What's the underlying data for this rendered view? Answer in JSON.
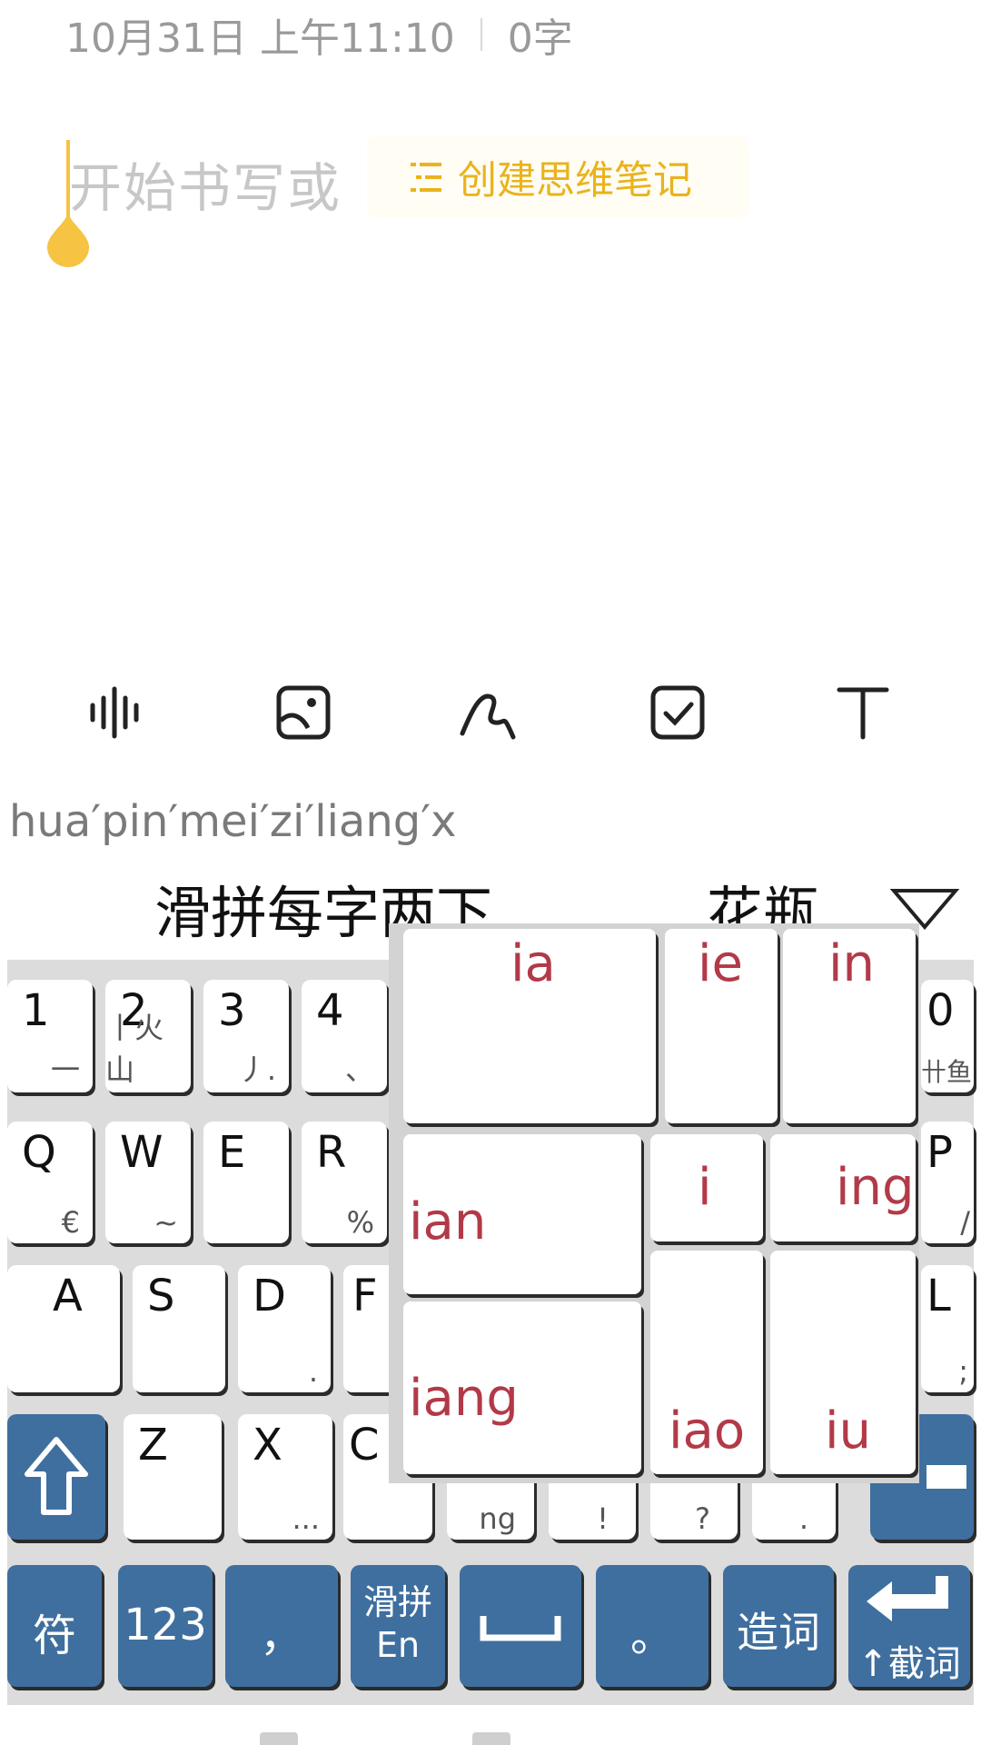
{
  "note": {
    "date_time": "10月31日 上午11:10",
    "word_count": "0字",
    "placeholder": "开始书写或",
    "mindmap_button_label": "创建思维笔记",
    "accent_color": "#eab31d"
  },
  "toolbar": {
    "icons": [
      "voice-icon",
      "image-icon",
      "handwriting-icon",
      "checkbox-icon",
      "text-format-icon"
    ]
  },
  "ime": {
    "composition": "hua′pin′mei′zi′liang′x",
    "candidates": [
      "滑拼每字两下",
      "花瓶"
    ]
  },
  "keyboard": {
    "row1": [
      {
        "main": "1",
        "sub": "一"
      },
      {
        "main": "2",
        "sub": "丨火山"
      },
      {
        "main": "3",
        "sub": "丿."
      },
      {
        "main": "4",
        "sub": "、"
      },
      {
        "main": "0",
        "sub": "卄鱼"
      }
    ],
    "row2": [
      {
        "main": "Q",
        "sub": "€"
      },
      {
        "main": "W",
        "sub": "~"
      },
      {
        "main": "E",
        "sub": ""
      },
      {
        "main": "R",
        "sub": "%"
      },
      {
        "main": "P",
        "sub": "/"
      }
    ],
    "row3": [
      {
        "main": "A",
        "sub": ""
      },
      {
        "main": "S",
        "sub": ""
      },
      {
        "main": "D",
        "sub": "."
      },
      {
        "main": "F",
        "sub": ""
      },
      {
        "main": "L",
        "sub": ";"
      }
    ],
    "row4": [
      {
        "main": "Z",
        "sub": ""
      },
      {
        "main": "X",
        "sub": "..."
      },
      {
        "main": "C",
        "sub": ""
      },
      {
        "main": "",
        "sub": "ng"
      },
      {
        "main": "",
        "sub": "!"
      },
      {
        "main": "",
        "sub": "?"
      },
      {
        "main": "",
        "sub": "."
      }
    ],
    "bottom": {
      "symbols": "符",
      "numbers": "123",
      "comma": "，",
      "swipe_top": "滑拼",
      "swipe_bottom": "En",
      "period": "。",
      "make_word": "造词",
      "enter_sub": "↑截词"
    },
    "key_blue": "#3f6f9e"
  },
  "popup": {
    "finals": [
      "ia",
      "ie",
      "in",
      "ian",
      "i",
      "ing",
      "iang",
      "iao",
      "iu"
    ],
    "text_color": "#b23a48"
  }
}
